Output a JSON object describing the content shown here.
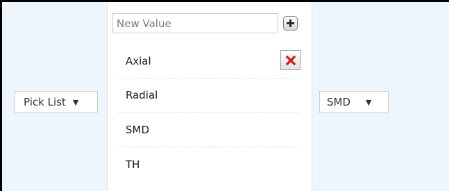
{
  "type_select": {
    "value": "Pick List",
    "icon": "dropdown-arrow-icon"
  },
  "new_value": {
    "placeholder": "New Value",
    "value": "",
    "add_icon": "plus-icon"
  },
  "values": [
    {
      "label": "Axial",
      "delete_icon": "delete-x-icon"
    },
    {
      "label": "Radial"
    },
    {
      "label": "SMD"
    },
    {
      "label": "TH"
    }
  ],
  "default_select": {
    "value": "SMD",
    "icon": "dropdown-arrow-icon"
  },
  "colors": {
    "column_bg": "#eef6fd",
    "delete_red": "#dd1111",
    "frame": "#000000"
  }
}
